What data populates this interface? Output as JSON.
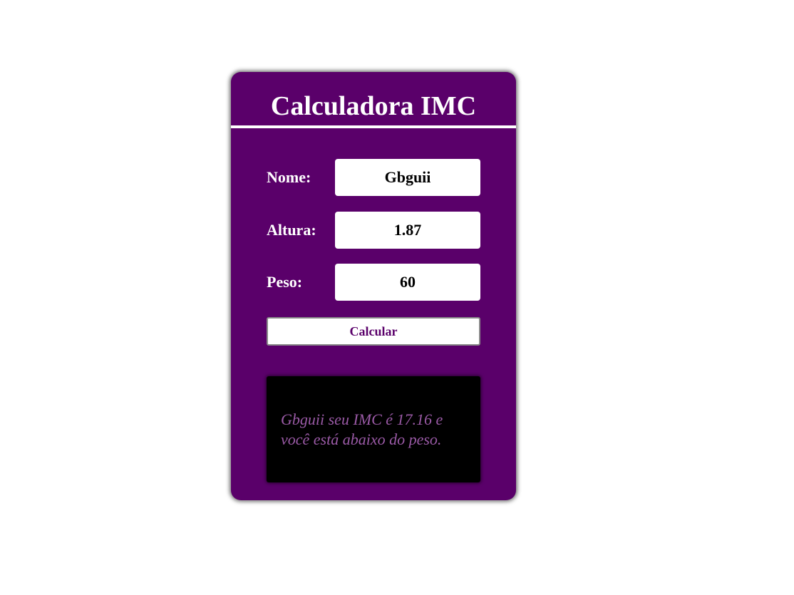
{
  "app": {
    "title": "Calculadora IMC"
  },
  "form": {
    "name_label": "Nome:",
    "name_value": "Gbguii",
    "height_label": "Altura:",
    "height_value": "1.87",
    "weight_label": "Peso:",
    "weight_value": "60",
    "calculate_label": "Calcular"
  },
  "result": {
    "text": "Gbguii seu IMC é 17.16 e você está abaixo do peso."
  },
  "colors": {
    "card_background": "#5a006a",
    "result_background": "#000000",
    "result_text": "#9a5aa6",
    "button_text": "#5a006a"
  }
}
